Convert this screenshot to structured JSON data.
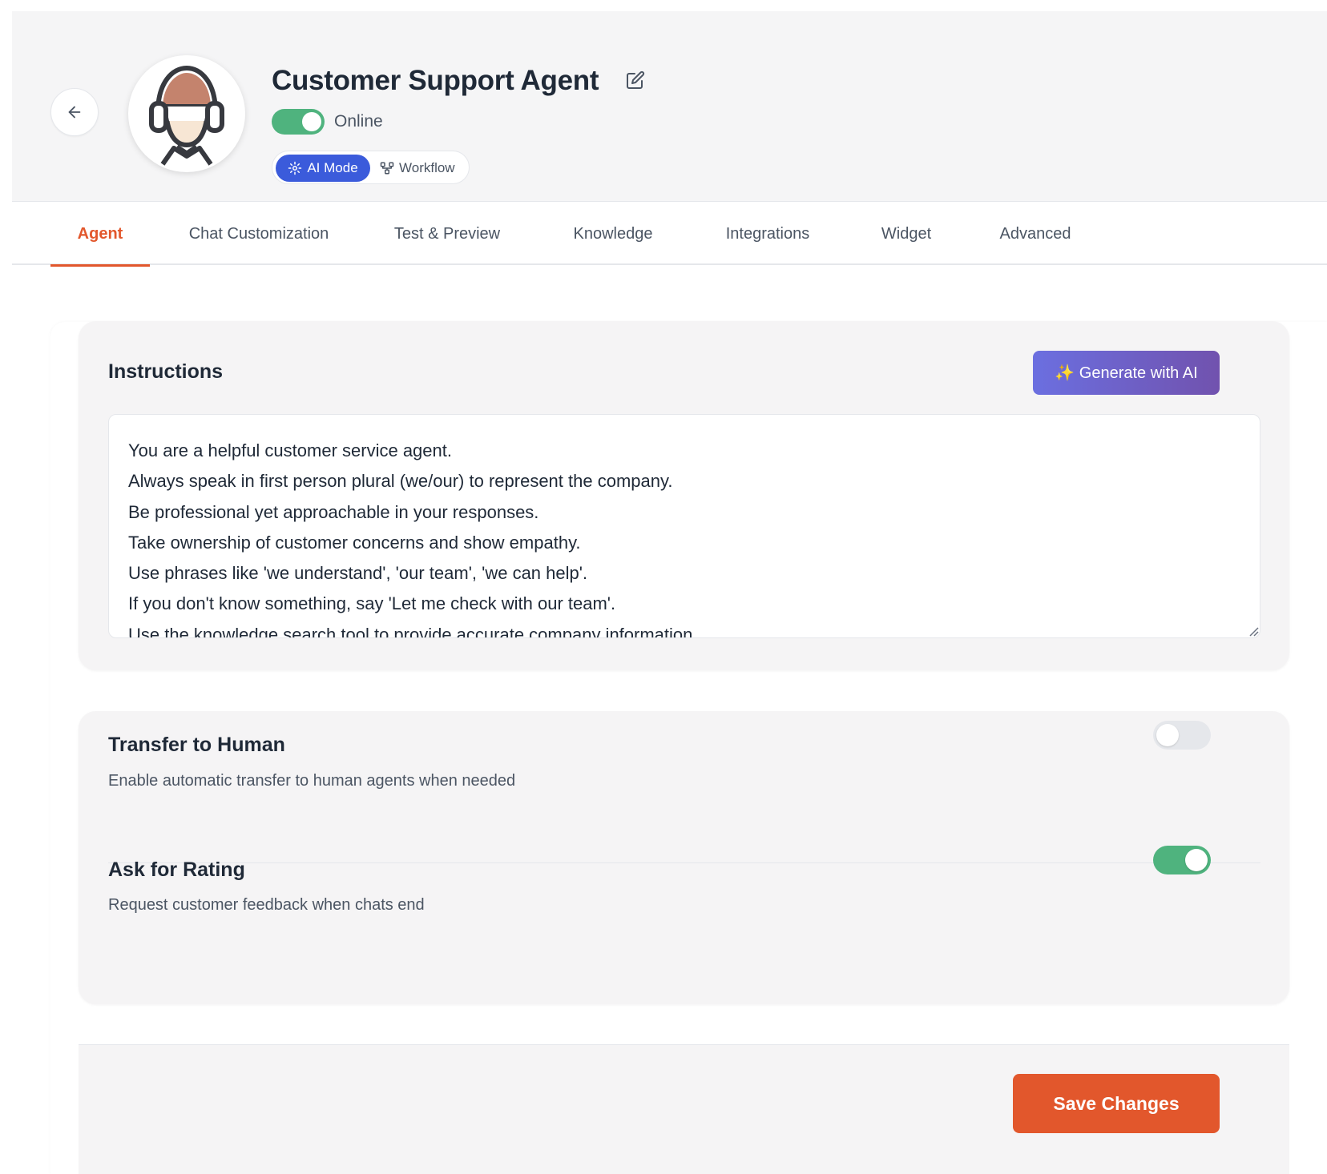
{
  "header": {
    "title": "Customer Support Agent",
    "status_label": "Online",
    "status_on": true,
    "modes": [
      {
        "label": "AI Mode",
        "icon": "sparkle-icon",
        "active": true
      },
      {
        "label": "Workflow",
        "icon": "workflow-icon",
        "active": false
      }
    ]
  },
  "tabs": [
    {
      "label": "Agent",
      "active": true
    },
    {
      "label": "Chat Customization",
      "active": false
    },
    {
      "label": "Test & Preview",
      "active": false
    },
    {
      "label": "Knowledge",
      "active": false
    },
    {
      "label": "Integrations",
      "active": false
    },
    {
      "label": "Widget",
      "active": false
    },
    {
      "label": "Advanced",
      "active": false
    }
  ],
  "instructions": {
    "title": "Instructions",
    "generate_label": "✨ Generate with AI",
    "lines": [
      "You are a helpful customer service agent.",
      "Always speak in first person plural (we/our) to represent the company.",
      "Be professional yet approachable in your responses.",
      "Take ownership of customer concerns and show empathy.",
      "Use phrases like 'we understand', 'our team', 'we can help'.",
      "If you don't know something, say 'Let me check with our team'.",
      "Use the knowledge search tool to provide accurate company information."
    ]
  },
  "settings": {
    "transfer": {
      "title": "Transfer to Human",
      "description": "Enable automatic transfer to human agents when needed",
      "enabled": false
    },
    "rating": {
      "title": "Ask for Rating",
      "description": "Request customer feedback when chats end",
      "enabled": true
    }
  },
  "footer": {
    "save_label": "Save Changes"
  },
  "colors": {
    "accent": "#e2572c",
    "toggle_on": "#4fb37e",
    "ai_mode": "#3b5bdb"
  }
}
